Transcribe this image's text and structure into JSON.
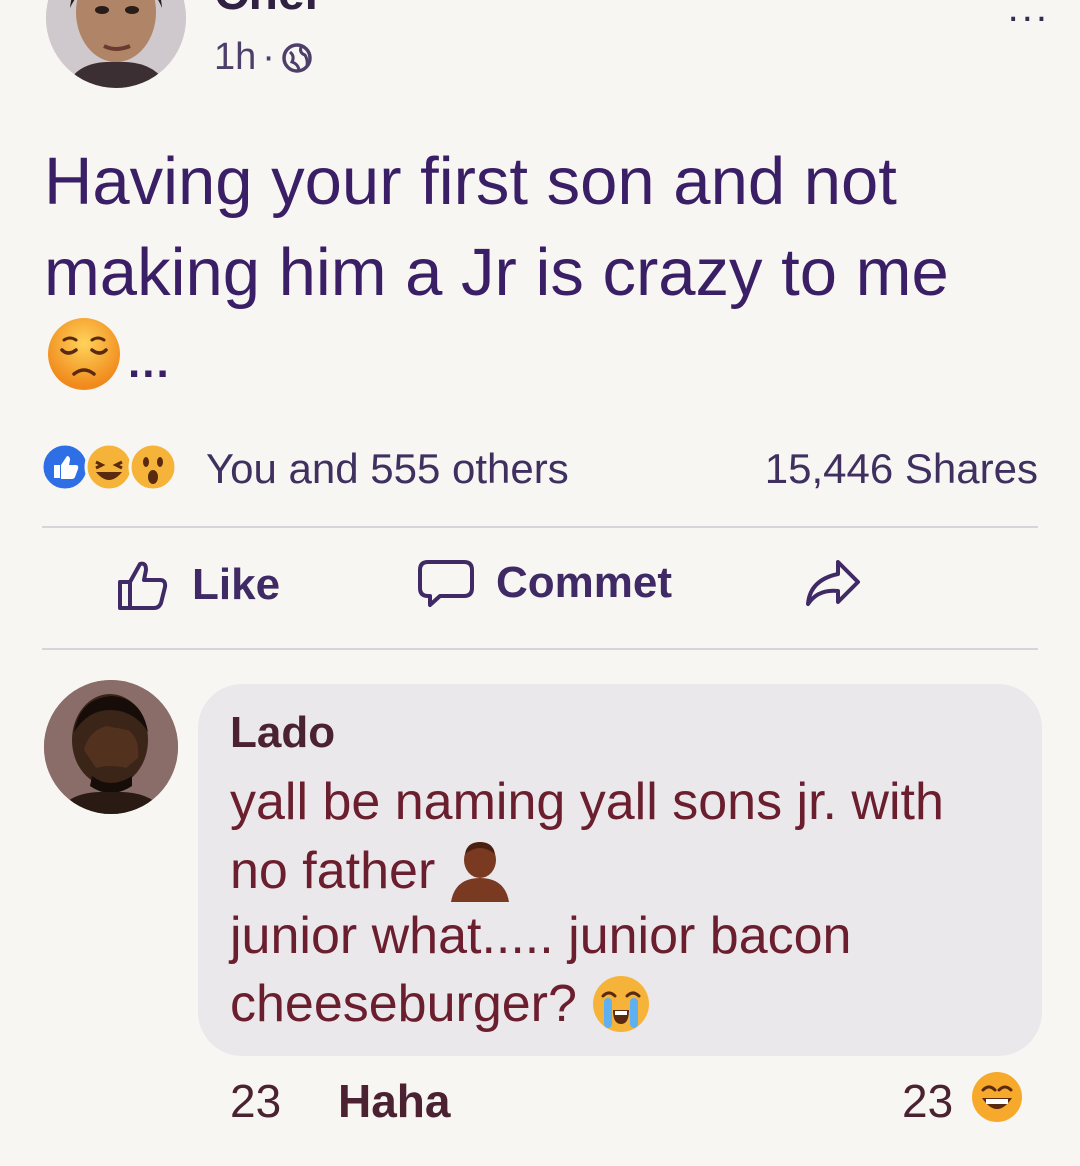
{
  "post": {
    "author": "Chel",
    "time": "1h",
    "separator": "·",
    "privacy_icon": "globe-icon",
    "text": "Having your first son and not making him a Jr is crazy to me",
    "text_emoji": "pensive-face-emoji",
    "ellipsis": "...",
    "more_icon": "more-options-icon",
    "more_label": "..."
  },
  "reactions": {
    "icons": [
      "like-reaction-icon",
      "haha-reaction-icon",
      "wow-reaction-icon"
    ],
    "summary": "You and 555 others",
    "shares": "15,446 Shares"
  },
  "actions": {
    "like_label": "Like",
    "comment_label": "Commet",
    "share_icon": "share-arrow-icon"
  },
  "comment": {
    "author": "Lado",
    "lines": [
      "yall be naming yall sons jr. with",
      "no father",
      "junior what..... junior bacon",
      "cheeseburger?"
    ],
    "emojis": [
      "person-silhouette-emoji",
      "crying-face-emoji"
    ],
    "footer_count": "23",
    "footer_reaction_label": "Haha",
    "reaction_count": "23",
    "reaction_icon": "haha-reaction-icon"
  },
  "colors": {
    "background": "#f7f6f2",
    "post_text": "#3a1f66",
    "comment_text": "#6a1e2e",
    "bubble": "#ebe8ec"
  }
}
